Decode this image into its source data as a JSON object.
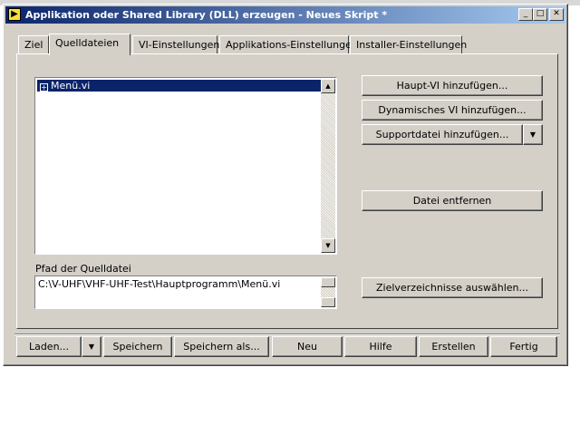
{
  "window": {
    "title": "Applikation oder Shared Library (DLL) erzeugen - Neues Skript *",
    "caption_buttons": {
      "minimize": "_",
      "maximize": "□",
      "close": "✕"
    }
  },
  "tabs": [
    {
      "label": "Ziel",
      "active": false
    },
    {
      "label": "Quelldateien",
      "active": true
    },
    {
      "label": "VI-Einstellungen",
      "active": false
    },
    {
      "label": "Applikations-Einstellungen",
      "active": false
    },
    {
      "label": "Installer-Einstellungen",
      "active": false
    }
  ],
  "source_list": {
    "items": [
      {
        "label": "Menü.vi",
        "expander": "⊞",
        "selected": true
      }
    ]
  },
  "path": {
    "label": "Pfad der Quelldatei",
    "value": "C:\\V-UHF\\VHF-UHF-Test\\Hauptprogramm\\Menü.vi"
  },
  "actions": {
    "add_main_vi": "Haupt-VI hinzufügen...",
    "add_dynamic_vi": "Dynamisches VI hinzufügen...",
    "add_support_file": "Supportdatei hinzufügen...",
    "remove_file": "Datei entfernen",
    "select_target_dirs": "Zielverzeichnisse auswählen..."
  },
  "footer": {
    "load": "Laden...",
    "save": "Speichern",
    "save_as": "Speichern als...",
    "new": "Neu",
    "help": "Hilfe",
    "build": "Erstellen",
    "done": "Fertig"
  },
  "icons": {
    "dropdown": "▼",
    "scroll_up": "▲",
    "scroll_down": "▼"
  },
  "colors": {
    "face": "#d4d0c8",
    "title_start": "#0a246a",
    "title_end": "#a6caf0",
    "selection": "#0a246a"
  }
}
